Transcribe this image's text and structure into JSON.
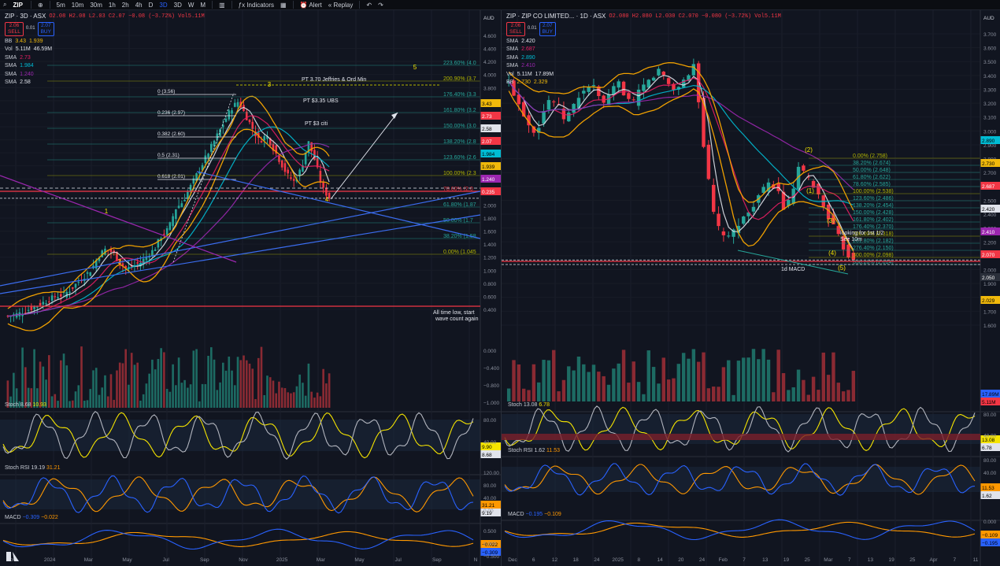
{
  "toolbar": {
    "symbol": "ZIP",
    "intervals": [
      "5m",
      "10m",
      "30m",
      "1h",
      "2h",
      "4h",
      "D",
      "3D",
      "3D",
      "W",
      "M"
    ],
    "active_interval": "3D",
    "indicators_label": "Indicators",
    "alert_label": "Alert",
    "replay_label": "Replay"
  },
  "left": {
    "title": "ZIP · 3D · ASX",
    "ohlc": "O2.08 H2.08 L2.03 C2.07 −0.08 (−3.72%) Vol5.11M",
    "sell_price": "2.06",
    "buy_price": "2.07",
    "sell_label": "SELL",
    "buy_label": "BUY",
    "spread": "0.01",
    "currency": "AUD",
    "legend": [
      {
        "name": "BB",
        "v1": "3.43",
        "v2": "1.939",
        "color": "#f0b90b"
      },
      {
        "name": "Vol",
        "v1": "5.11M",
        "v2": "46.59M",
        "color": "#e0e3eb"
      },
      {
        "name": "SMA",
        "v1": "2.73",
        "v2": "",
        "color": "#e91e63"
      },
      {
        "name": "SMA",
        "v1": "1.984",
        "v2": "",
        "color": "#00bcd4"
      },
      {
        "name": "SMA",
        "v1": "1.240",
        "v2": "",
        "color": "#9c27b0"
      },
      {
        "name": "SMA",
        "v1": "2.58",
        "v2": "",
        "color": "#e0e3eb"
      }
    ],
    "stoch": {
      "label": "Stoch",
      "k": "8.68",
      "d": "10.93"
    },
    "stochrsi": {
      "label": "Stoch RSI",
      "k": "19.19",
      "d": "31.21"
    },
    "macd": {
      "label": "MACD",
      "macd": "−0.309",
      "signal": "−0.022"
    },
    "price_ticks": [
      "4.600",
      "4.400",
      "4.200",
      "4.000",
      "3.800",
      "3.600",
      "3.400",
      "3.200",
      "3.000",
      "2.800",
      "2.600",
      "2.400",
      "2.200",
      "2.000",
      "1.800",
      "1.600",
      "1.400",
      "1.200",
      "1.000",
      "0.800",
      "0.600",
      "0.400"
    ],
    "time_ticks": [
      "Nov",
      "2024",
      "Mar",
      "May",
      "Jul",
      "Sep",
      "Nov",
      "2025",
      "Mar",
      "May",
      "Jul",
      "Sep",
      "N"
    ],
    "fib_labels": [
      {
        "t": "223.60% (4.0",
        "color": "#26a69a"
      },
      {
        "t": "200.90% (3.7",
        "color": "#b2b500"
      },
      {
        "t": "176.40% (3.3",
        "color": "#26a69a"
      },
      {
        "t": "161.80% (3.2",
        "color": "#26a69a"
      },
      {
        "t": "150.00% (3.0",
        "color": "#26a69a"
      },
      {
        "t": "138.20% (2.8",
        "color": "#26a69a"
      },
      {
        "t": "123.60% (2.6",
        "color": "#26a69a"
      },
      {
        "t": "100.00% (2.3",
        "color": "#b2b500"
      },
      {
        "t": "78.60% (2.0",
        "color": "#f23645"
      },
      {
        "t": "61.80% (1.87",
        "color": "#26a69a"
      },
      {
        "t": "50.00% (1.7",
        "color": "#26a69a"
      },
      {
        "t": "38.20% (1.58",
        "color": "#26a69a"
      },
      {
        "t": "0.00% (1.045",
        "color": "#b2b500"
      }
    ],
    "retrace_labels": [
      "0 (3.56)",
      "0.236 (2.97)",
      "0.382 (2.60)",
      "0.5 (2.31)",
      "0.618 (2.01)"
    ],
    "annotations": [
      {
        "t": "PT 3.70 Jeffries & Ord Min"
      },
      {
        "t": "PT $3.35 UBS"
      },
      {
        "t": "PT $3 citi"
      },
      {
        "t": "All time low, start"
      },
      {
        "t": "wave count again"
      }
    ],
    "wave_labels": [
      "1",
      "2",
      "3",
      "4",
      "5"
    ],
    "price_tags": [
      {
        "t": "3.43",
        "bg": "#f0b90b",
        "fg": "#000"
      },
      {
        "t": "2.73",
        "bg": "#f23645",
        "fg": "#fff"
      },
      {
        "t": "2.58",
        "bg": "#e0e3eb",
        "fg": "#000"
      },
      {
        "t": "2.07",
        "bg": "#f23645",
        "fg": "#fff"
      },
      {
        "t": "1.984",
        "bg": "#00bcd4",
        "fg": "#000"
      },
      {
        "t": "1.939",
        "bg": "#f0b90b",
        "fg": "#000"
      },
      {
        "t": "1.240",
        "bg": "#9c27b0",
        "fg": "#fff"
      },
      {
        "t": "0.235",
        "bg": "#f23645",
        "fg": "#fff"
      }
    ],
    "indicator_ticks": {
      "stoch": [
        "80.00",
        "40.00"
      ],
      "stochrsi": [
        "120.00",
        "80.00",
        "40.00",
        "0.00"
      ],
      "macd": [
        "0.500",
        "0.000",
        "−0.500"
      ],
      "volume": [
        "0.000",
        "−0.400",
        "−0.800",
        "−1.000"
      ]
    },
    "stoch_tags": [
      "9.90",
      "8.68"
    ],
    "stochrsi_tags": [
      "31.21",
      "9.19"
    ],
    "macd_tags": [
      "−0.022",
      "−0.309"
    ]
  },
  "right": {
    "title": "ZIP · ZIP CO LIMITED... · 1D · ASX",
    "ohlc": "O2.080 H2.080 L2.030 C2.070 −0.080 (−3.72%) Vol5.11M",
    "sell_price": "2.06",
    "buy_price": "2.07",
    "sell_label": "SELL",
    "buy_label": "BUY",
    "spread": "0.01",
    "currency": "AUD",
    "legend": [
      {
        "name": "SMA",
        "v1": "2.420",
        "v2": "",
        "color": "#e0e3eb"
      },
      {
        "name": "SMA",
        "v1": "2.687",
        "v2": "",
        "color": "#e91e63"
      },
      {
        "name": "SMA",
        "v1": "2.890",
        "v2": "",
        "color": "#00bcd4"
      },
      {
        "name": "SMA",
        "v1": "2.410",
        "v2": "",
        "color": "#9c27b0"
      },
      {
        "name": "Vol",
        "v1": "5.11M",
        "v2": "17.89M",
        "color": "#e0e3eb"
      },
      {
        "name": "BB",
        "v1": "2.730",
        "v2": "2.329",
        "color": "#f0b90b"
      }
    ],
    "stoch": {
      "label": "Stoch",
      "k": "13.08",
      "d": "6.78"
    },
    "stochrsi": {
      "label": "Stoch RSI",
      "k": "1.62",
      "d": "11.53"
    },
    "macd": {
      "label": "MACD",
      "macd": "−0.195",
      "signal": "−0.109"
    },
    "price_ticks": [
      "3.700",
      "3.600",
      "3.500",
      "3.400",
      "3.300",
      "3.200",
      "3.100",
      "3.000",
      "2.900",
      "2.800",
      "2.700",
      "2.600",
      "2.500",
      "2.400",
      "2.300",
      "2.200",
      "2.100",
      "2.000",
      "1.900",
      "1.800",
      "1.700",
      "1.600"
    ],
    "time_ticks": [
      "Dec",
      "6",
      "12",
      "18",
      "24",
      "2025",
      "8",
      "14",
      "20",
      "24",
      "Feb",
      "7",
      "13",
      "19",
      "25",
      "Mar",
      "7",
      "13",
      "19",
      "25",
      "Apr",
      "7",
      "11"
    ],
    "fib_labels": [
      {
        "t": "0.00% (2.758)",
        "color": "#b2b500"
      },
      {
        "t": "38.20% (2.674)",
        "color": "#26a69a"
      },
      {
        "t": "50.00% (2.648)",
        "color": "#26a69a"
      },
      {
        "t": "61.80% (2.622)",
        "color": "#26a69a"
      },
      {
        "t": "78.60% (2.585)",
        "color": "#26a69a"
      },
      {
        "t": "100.00% (2.538)",
        "color": "#b2b500"
      },
      {
        "t": "123.60% (2.486)",
        "color": "#26a69a"
      },
      {
        "t": "138.20% (2.454)",
        "color": "#26a69a"
      },
      {
        "t": "150.00% (2.428)",
        "color": "#26a69a"
      },
      {
        "t": "161.80% (2.402)",
        "color": "#26a69a"
      },
      {
        "t": "176.40% (2.370)",
        "color": "#26a69a"
      },
      {
        "t": "200.00% (2.318)",
        "color": "#b2b500"
      },
      {
        "t": "261.80% (2.182)",
        "color": "#26a69a"
      },
      {
        "t": "276.40% (2.150)",
        "color": "#26a69a"
      },
      {
        "t": "300.00% (2.098)",
        "color": "#b2b500"
      },
      {
        "t": "338.20% (2.014)",
        "color": "#26a69a"
      }
    ],
    "annotations": [
      {
        "t": "looking for 1st 1/2"
      },
      {
        "t": "See 10m"
      },
      {
        "t": "1d MACD"
      }
    ],
    "wave_labels": [
      "(2)",
      "(1)",
      "(3)",
      "(4)",
      "(5)"
    ],
    "price_tags": [
      {
        "t": "2.890",
        "bg": "#00bcd4",
        "fg": "#000"
      },
      {
        "t": "2.730",
        "bg": "#f0b90b",
        "fg": "#000"
      },
      {
        "t": "2.687",
        "bg": "#f23645",
        "fg": "#fff"
      },
      {
        "t": "2.420",
        "bg": "#e0e3eb",
        "fg": "#000"
      },
      {
        "t": "2.410",
        "bg": "#9c27b0",
        "fg": "#fff"
      },
      {
        "t": "2.070",
        "bg": "#f23645",
        "fg": "#fff"
      },
      {
        "t": "2.050",
        "bg": "#2a2f3a",
        "fg": "#fff"
      },
      {
        "t": "2.029",
        "bg": "#f0b90b",
        "fg": "#000"
      }
    ],
    "indicator_ticks": {
      "stoch": [
        "80.00",
        "40.00"
      ],
      "stochrsi": [
        "80.00",
        "40.00"
      ],
      "macd": [
        "0.000"
      ]
    },
    "volume_tags": [
      "17.89M",
      "5.11M"
    ],
    "stoch_tags": [
      "13.08",
      "6.78"
    ],
    "stochrsi_tags": [
      "11.53",
      "1.62"
    ],
    "macd_tags": [
      "−0.109",
      "−0.195"
    ]
  },
  "chart_data": [
    {
      "type": "candlestick",
      "title": "ZIP · 3D · ASX",
      "xlabel": "",
      "ylabel": "",
      "x_range": [
        "Nov 2023",
        "Nov 2025"
      ],
      "ylim": [
        0.4,
        4.6
      ],
      "close_path": [
        0.3,
        0.32,
        0.35,
        0.4,
        0.45,
        0.5,
        0.55,
        0.6,
        0.62,
        0.7,
        0.8,
        0.9,
        1.0,
        1.2,
        1.3,
        1.25,
        1.1,
        1.0,
        1.05,
        1.1,
        1.2,
        1.3,
        1.5,
        1.6,
        1.9,
        2.0,
        2.2,
        2.4,
        2.6,
        2.8,
        3.0,
        3.2,
        3.4,
        3.5,
        3.3,
        3.1,
        2.9,
        3.0,
        2.8,
        2.6,
        2.4,
        2.3,
        2.5,
        2.9,
        2.6,
        2.2,
        2.07
      ],
      "series": [
        {
          "name": "BB",
          "values": [
            3.43,
            1.939
          ]
        },
        {
          "name": "SMA",
          "values": [
            2.73
          ]
        },
        {
          "name": "SMA",
          "values": [
            1.984
          ]
        },
        {
          "name": "SMA",
          "values": [
            1.24
          ]
        },
        {
          "name": "SMA",
          "values": [
            2.58
          ]
        }
      ],
      "indicators": {
        "stoch": [
          8.68,
          10.93
        ],
        "stoch_rsi": [
          19.19,
          31.21
        ],
        "macd": [
          -0.309,
          -0.022
        ]
      },
      "grid": true,
      "legend": "top-left"
    },
    {
      "type": "candlestick",
      "title": "ZIP · ZIP CO LIMITED... · 1D · ASX",
      "xlabel": "",
      "ylabel": "",
      "x_range": [
        "Dec 2024",
        "Apr 2025"
      ],
      "ylim": [
        1.6,
        3.7
      ],
      "close_path": [
        3.3,
        3.2,
        3.1,
        3.0,
        2.95,
        3.1,
        3.2,
        3.15,
        3.05,
        3.1,
        3.2,
        3.25,
        3.3,
        3.2,
        3.15,
        3.25,
        3.3,
        3.2,
        3.15,
        3.25,
        3.3,
        3.35,
        3.4,
        3.3,
        3.25,
        3.3,
        3.35,
        3.45,
        2.95,
        2.6,
        2.3,
        2.25,
        2.2,
        2.3,
        2.35,
        2.4,
        2.5,
        2.55,
        2.6,
        2.55,
        2.4,
        2.5,
        2.7,
        2.65,
        2.6,
        2.5,
        2.4,
        2.3,
        2.2,
        2.1,
        2.07
      ],
      "series": [
        {
          "name": "SMA",
          "values": [
            2.42
          ]
        },
        {
          "name": "SMA",
          "values": [
            2.687
          ]
        },
        {
          "name": "SMA",
          "values": [
            2.89
          ]
        },
        {
          "name": "SMA",
          "values": [
            2.41
          ]
        },
        {
          "name": "BB",
          "values": [
            2.73,
            2.329
          ]
        }
      ],
      "indicators": {
        "stoch": [
          13.08,
          6.78
        ],
        "stoch_rsi": [
          1.62,
          11.53
        ],
        "macd": [
          -0.195,
          -0.109
        ]
      },
      "grid": true,
      "legend": "top-left"
    }
  ]
}
